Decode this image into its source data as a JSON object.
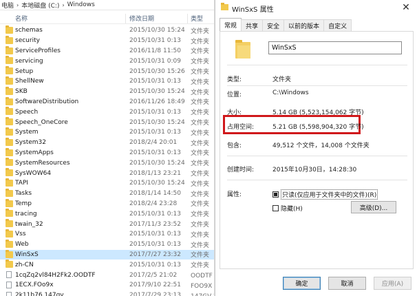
{
  "explorer": {
    "breadcrumb": [
      "电脑",
      "本地磁盘 (C:)",
      "Windows"
    ],
    "columns": {
      "name": "名称",
      "date": "修改日期",
      "type": "类型"
    },
    "rows": [
      {
        "name": "schemas",
        "date": "2015/10/30 15:24",
        "type": "文件夹",
        "icon": "folder"
      },
      {
        "name": "security",
        "date": "2015/10/31 0:13",
        "type": "文件夹",
        "icon": "folder"
      },
      {
        "name": "ServiceProfiles",
        "date": "2016/11/8 11:50",
        "type": "文件夹",
        "icon": "folder"
      },
      {
        "name": "servicing",
        "date": "2015/10/31 0:09",
        "type": "文件夹",
        "icon": "folder"
      },
      {
        "name": "Setup",
        "date": "2015/10/30 15:26",
        "type": "文件夹",
        "icon": "folder"
      },
      {
        "name": "ShellNew",
        "date": "2015/10/31 0:13",
        "type": "文件夹",
        "icon": "folder"
      },
      {
        "name": "SKB",
        "date": "2015/10/30 15:24",
        "type": "文件夹",
        "icon": "folder"
      },
      {
        "name": "SoftwareDistribution",
        "date": "2016/11/26 18:49",
        "type": "文件夹",
        "icon": "folder"
      },
      {
        "name": "Speech",
        "date": "2015/10/31 0:13",
        "type": "文件夹",
        "icon": "folder"
      },
      {
        "name": "Speech_OneCore",
        "date": "2015/10/30 15:24",
        "type": "文件夹",
        "icon": "folder"
      },
      {
        "name": "System",
        "date": "2015/10/31 0:13",
        "type": "文件夹",
        "icon": "folder"
      },
      {
        "name": "System32",
        "date": "2018/2/4 20:01",
        "type": "文件夹",
        "icon": "folder"
      },
      {
        "name": "SystemApps",
        "date": "2015/10/31 0:13",
        "type": "文件夹",
        "icon": "folder"
      },
      {
        "name": "SystemResources",
        "date": "2015/10/30 15:24",
        "type": "文件夹",
        "icon": "folder"
      },
      {
        "name": "SysWOW64",
        "date": "2018/1/13 23:21",
        "type": "文件夹",
        "icon": "folder"
      },
      {
        "name": "TAPI",
        "date": "2015/10/30 15:24",
        "type": "文件夹",
        "icon": "folder"
      },
      {
        "name": "Tasks",
        "date": "2018/1/14 14:50",
        "type": "文件夹",
        "icon": "folder"
      },
      {
        "name": "Temp",
        "date": "2018/2/4 23:28",
        "type": "文件夹",
        "icon": "folder"
      },
      {
        "name": "tracing",
        "date": "2015/10/31 0:13",
        "type": "文件夹",
        "icon": "folder"
      },
      {
        "name": "twain_32",
        "date": "2017/11/3 23:52",
        "type": "文件夹",
        "icon": "folder"
      },
      {
        "name": "Vss",
        "date": "2015/10/31 0:13",
        "type": "文件夹",
        "icon": "folder"
      },
      {
        "name": "Web",
        "date": "2015/10/31 0:13",
        "type": "文件夹",
        "icon": "folder"
      },
      {
        "name": "WinSxS",
        "date": "2017/7/27 23:32",
        "type": "文件夹",
        "icon": "folder",
        "selected": true
      },
      {
        "name": "zh-CN",
        "date": "2015/10/31 0:13",
        "type": "文件夹",
        "icon": "folder"
      },
      {
        "name": "1cqZq2vl84H2Fk2.OODTF",
        "date": "2017/2/5 21:02",
        "type": "OODTF 文",
        "icon": "file"
      },
      {
        "name": "1ECX.FOo9x",
        "date": "2017/9/10 22:51",
        "type": "FOO9X 文",
        "icon": "file"
      },
      {
        "name": "2k11b76.147gv",
        "date": "2017/7/29 23:13",
        "type": "147GV 文",
        "icon": "file"
      }
    ]
  },
  "dialog": {
    "title": "WinSxS 属性",
    "close_glyph": "✕",
    "tabs": [
      "常规",
      "共享",
      "安全",
      "以前的版本",
      "自定义"
    ],
    "folder_name": "WinSxS",
    "fields": {
      "type_label": "类型:",
      "type_value": "文件夹",
      "location_label": "位置:",
      "location_value": "C:\\Windows",
      "size_label": "大小:",
      "size_value": "5.14 GB (5,523,154,062 字节)",
      "disk_label": "占用空间:",
      "disk_value": "5.21 GB (5,598,904,320 字节)",
      "contains_label": "包含:",
      "contains_value": "49,512 个文件，14,008 个文件夹",
      "created_label": "创建时间:",
      "created_value": "2015年10月30日，14:28:30",
      "attributes_label": "属性:",
      "readonly_label": "只读(仅应用于文件夹中的文件)(R)",
      "hidden_label": "隐藏(H)",
      "advanced_label": "高级(D)..."
    },
    "buttons": {
      "ok": "确定",
      "cancel": "取消",
      "apply": "应用(A)"
    },
    "highlight_color": "#d0181b"
  }
}
